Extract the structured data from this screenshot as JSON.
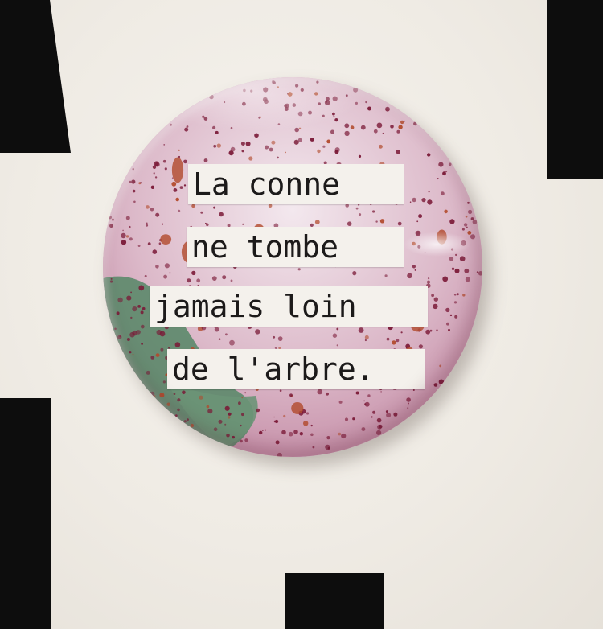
{
  "badge": {
    "lines": [
      "La conne",
      "ne tombe",
      "jamais loin",
      "de l'arbre."
    ]
  },
  "colors": {
    "background": "#f1ede6",
    "blocks": "#0d0d0d",
    "badge_base": "#d7b3c4",
    "splatter": "#7a1836",
    "rust_spots": "#b24a2c",
    "green_patch": "#5e8a6c",
    "label_paper": "#f4f1ec",
    "text": "#1c1a1a"
  }
}
